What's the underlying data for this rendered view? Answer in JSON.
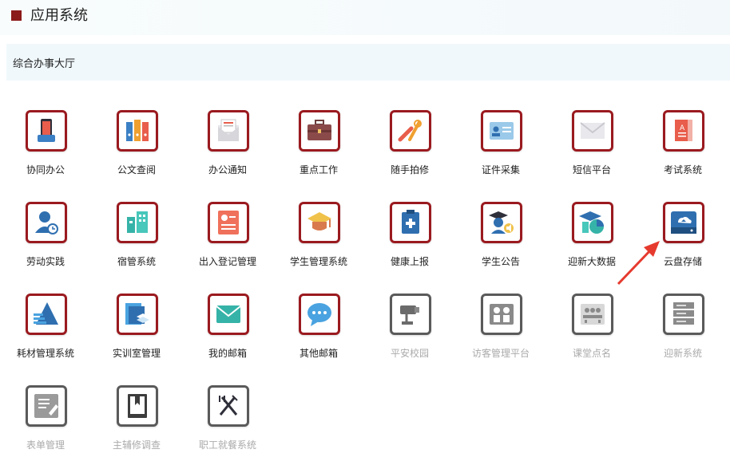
{
  "header": {
    "title": "应用系统"
  },
  "subnav": {
    "label": "综合办事大厅"
  },
  "colors": {
    "accent": "#9a1a1f",
    "disabled_border": "#5a5a5a",
    "arrow": "#e63a2e"
  },
  "apps": [
    {
      "name": "协同办公",
      "icon": "phone-icon",
      "enabled": true
    },
    {
      "name": "公文查阅",
      "icon": "binders-icon",
      "enabled": true
    },
    {
      "name": "办公通知",
      "icon": "envelope-open-icon",
      "enabled": true
    },
    {
      "name": "重点工作",
      "icon": "briefcase-icon",
      "enabled": true
    },
    {
      "name": "随手拍修",
      "icon": "tools-icon",
      "enabled": true
    },
    {
      "name": "证件采集",
      "icon": "id-card-icon",
      "enabled": true
    },
    {
      "name": "短信平台",
      "icon": "envelope-icon",
      "enabled": true
    },
    {
      "name": "考试系统",
      "icon": "book-icon",
      "enabled": true
    },
    {
      "name": "劳动实践",
      "icon": "worker-icon",
      "enabled": true
    },
    {
      "name": "宿管系统",
      "icon": "buildings-icon",
      "enabled": true
    },
    {
      "name": "出入登记管理",
      "icon": "register-icon",
      "enabled": true
    },
    {
      "name": "学生管理系统",
      "icon": "graduation-cap-icon",
      "enabled": true
    },
    {
      "name": "健康上报",
      "icon": "medical-clipboard-icon",
      "enabled": true
    },
    {
      "name": "学生公告",
      "icon": "student-announce-icon",
      "enabled": true
    },
    {
      "name": "迎新大数据",
      "icon": "cap-chart-icon",
      "enabled": true
    },
    {
      "name": "云盘存储",
      "icon": "cloud-drive-icon",
      "enabled": true
    },
    {
      "name": "耗材管理系统",
      "icon": "stack-triangle-icon",
      "enabled": true
    },
    {
      "name": "实训室管理",
      "icon": "layers-icon",
      "enabled": true
    },
    {
      "name": "我的邮箱",
      "icon": "mail-icon",
      "enabled": true
    },
    {
      "name": "其他邮箱",
      "icon": "chat-bubble-icon",
      "enabled": true
    },
    {
      "name": "平安校园",
      "icon": "camera-icon",
      "enabled": false
    },
    {
      "name": "访客管理平台",
      "icon": "visitors-icon",
      "enabled": false
    },
    {
      "name": "课堂点名",
      "icon": "classroom-icon",
      "enabled": false
    },
    {
      "name": "迎新系统",
      "icon": "server-icon",
      "enabled": false
    },
    {
      "name": "表单管理",
      "icon": "form-edit-icon",
      "enabled": false
    },
    {
      "name": "主辅修调查",
      "icon": "bookmark-book-icon",
      "enabled": false
    },
    {
      "name": "职工就餐系统",
      "icon": "fork-knife-icon",
      "enabled": false
    }
  ]
}
